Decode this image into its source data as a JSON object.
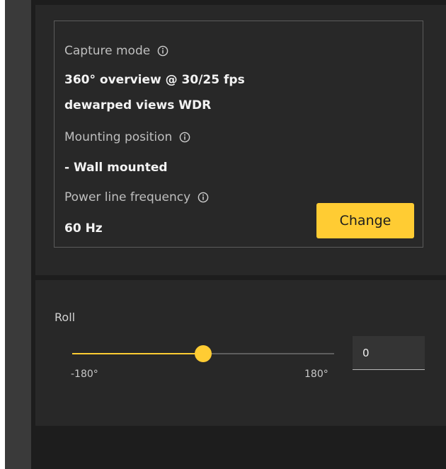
{
  "capture": {
    "label": "Capture mode",
    "value_line1": "360° overview @ 30/25 fps",
    "value_line2": "dewarped views WDR"
  },
  "mounting": {
    "label": "Mounting position",
    "value": "- Wall mounted"
  },
  "power": {
    "label": "Power line frequency",
    "value": "60 Hz"
  },
  "change_button": {
    "label": "Change"
  },
  "roll": {
    "label": "Roll",
    "min_label": "-180°",
    "max_label": "180°",
    "min": -180,
    "max": 180,
    "value": 0,
    "input_value": "0"
  },
  "colors": {
    "accent": "#ffcc33",
    "panel": "#282828",
    "background": "#1d1d1d"
  },
  "icons": {
    "info": "info-circle-icon"
  }
}
